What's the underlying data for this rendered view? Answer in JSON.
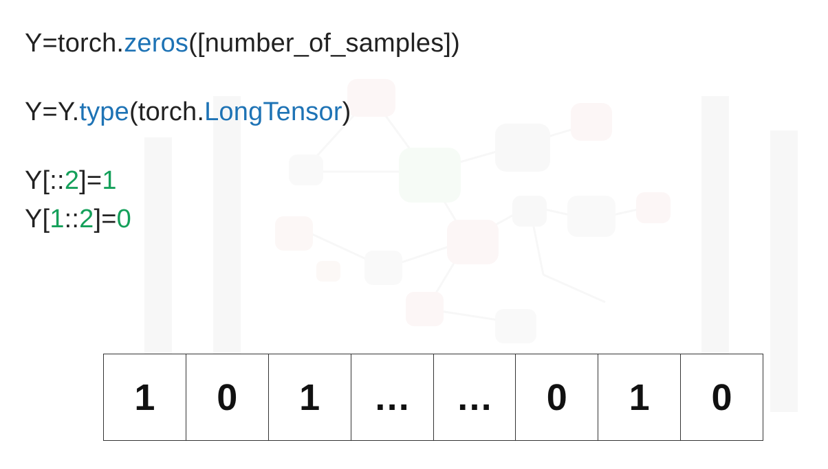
{
  "code": {
    "line1": {
      "parts": [
        {
          "text": "Y=torch.",
          "style": "plain"
        },
        {
          "text": "zeros",
          "style": "blue"
        },
        {
          "text": "([number_of_samples])",
          "style": "plain"
        }
      ]
    },
    "line2": {
      "parts": [
        {
          "text": "Y=Y.",
          "style": "plain"
        },
        {
          "text": "type",
          "style": "blue"
        },
        {
          "text": "(torch.",
          "style": "plain"
        },
        {
          "text": "LongTensor",
          "style": "blue"
        },
        {
          "text": ")",
          "style": "plain"
        }
      ]
    },
    "line3": {
      "parts": [
        {
          "text": "Y[::",
          "style": "plain"
        },
        {
          "text": "2",
          "style": "green"
        },
        {
          "text": "]=",
          "style": "plain"
        },
        {
          "text": "1",
          "style": "green"
        }
      ]
    },
    "line4": {
      "parts": [
        {
          "text": "Y[",
          "style": "plain"
        },
        {
          "text": "1",
          "style": "green"
        },
        {
          "text": "::",
          "style": "plain"
        },
        {
          "text": "2",
          "style": "green"
        },
        {
          "text": "]=",
          "style": "plain"
        },
        {
          "text": "0",
          "style": "green"
        }
      ]
    }
  },
  "tensor": {
    "cells": [
      "1",
      "0",
      "1",
      "…",
      "…",
      "0",
      "1",
      "0"
    ]
  },
  "colors": {
    "text": "#222222",
    "keyword_blue": "#1e73b5",
    "number_green": "#14a05a",
    "cell_border": "#333333"
  }
}
